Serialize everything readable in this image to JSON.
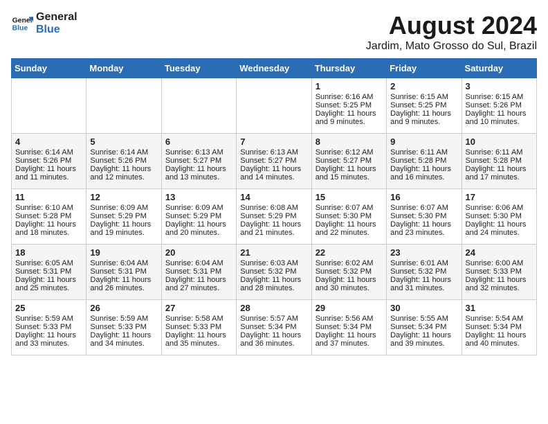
{
  "header": {
    "logo_line1": "General",
    "logo_line2": "Blue",
    "title": "August 2024",
    "subtitle": "Jardim, Mato Grosso do Sul, Brazil"
  },
  "days_of_week": [
    "Sunday",
    "Monday",
    "Tuesday",
    "Wednesday",
    "Thursday",
    "Friday",
    "Saturday"
  ],
  "weeks": [
    [
      {
        "day": "",
        "content": ""
      },
      {
        "day": "",
        "content": ""
      },
      {
        "day": "",
        "content": ""
      },
      {
        "day": "",
        "content": ""
      },
      {
        "day": "1",
        "content": "Sunrise: 6:16 AM\nSunset: 5:25 PM\nDaylight: 11 hours\nand 9 minutes."
      },
      {
        "day": "2",
        "content": "Sunrise: 6:15 AM\nSunset: 5:25 PM\nDaylight: 11 hours\nand 9 minutes."
      },
      {
        "day": "3",
        "content": "Sunrise: 6:15 AM\nSunset: 5:26 PM\nDaylight: 11 hours\nand 10 minutes."
      }
    ],
    [
      {
        "day": "4",
        "content": "Sunrise: 6:14 AM\nSunset: 5:26 PM\nDaylight: 11 hours\nand 11 minutes."
      },
      {
        "day": "5",
        "content": "Sunrise: 6:14 AM\nSunset: 5:26 PM\nDaylight: 11 hours\nand 12 minutes."
      },
      {
        "day": "6",
        "content": "Sunrise: 6:13 AM\nSunset: 5:27 PM\nDaylight: 11 hours\nand 13 minutes."
      },
      {
        "day": "7",
        "content": "Sunrise: 6:13 AM\nSunset: 5:27 PM\nDaylight: 11 hours\nand 14 minutes."
      },
      {
        "day": "8",
        "content": "Sunrise: 6:12 AM\nSunset: 5:27 PM\nDaylight: 11 hours\nand 15 minutes."
      },
      {
        "day": "9",
        "content": "Sunrise: 6:11 AM\nSunset: 5:28 PM\nDaylight: 11 hours\nand 16 minutes."
      },
      {
        "day": "10",
        "content": "Sunrise: 6:11 AM\nSunset: 5:28 PM\nDaylight: 11 hours\nand 17 minutes."
      }
    ],
    [
      {
        "day": "11",
        "content": "Sunrise: 6:10 AM\nSunset: 5:28 PM\nDaylight: 11 hours\nand 18 minutes."
      },
      {
        "day": "12",
        "content": "Sunrise: 6:09 AM\nSunset: 5:29 PM\nDaylight: 11 hours\nand 19 minutes."
      },
      {
        "day": "13",
        "content": "Sunrise: 6:09 AM\nSunset: 5:29 PM\nDaylight: 11 hours\nand 20 minutes."
      },
      {
        "day": "14",
        "content": "Sunrise: 6:08 AM\nSunset: 5:29 PM\nDaylight: 11 hours\nand 21 minutes."
      },
      {
        "day": "15",
        "content": "Sunrise: 6:07 AM\nSunset: 5:30 PM\nDaylight: 11 hours\nand 22 minutes."
      },
      {
        "day": "16",
        "content": "Sunrise: 6:07 AM\nSunset: 5:30 PM\nDaylight: 11 hours\nand 23 minutes."
      },
      {
        "day": "17",
        "content": "Sunrise: 6:06 AM\nSunset: 5:30 PM\nDaylight: 11 hours\nand 24 minutes."
      }
    ],
    [
      {
        "day": "18",
        "content": "Sunrise: 6:05 AM\nSunset: 5:31 PM\nDaylight: 11 hours\nand 25 minutes."
      },
      {
        "day": "19",
        "content": "Sunrise: 6:04 AM\nSunset: 5:31 PM\nDaylight: 11 hours\nand 26 minutes."
      },
      {
        "day": "20",
        "content": "Sunrise: 6:04 AM\nSunset: 5:31 PM\nDaylight: 11 hours\nand 27 minutes."
      },
      {
        "day": "21",
        "content": "Sunrise: 6:03 AM\nSunset: 5:32 PM\nDaylight: 11 hours\nand 28 minutes."
      },
      {
        "day": "22",
        "content": "Sunrise: 6:02 AM\nSunset: 5:32 PM\nDaylight: 11 hours\nand 30 minutes."
      },
      {
        "day": "23",
        "content": "Sunrise: 6:01 AM\nSunset: 5:32 PM\nDaylight: 11 hours\nand 31 minutes."
      },
      {
        "day": "24",
        "content": "Sunrise: 6:00 AM\nSunset: 5:33 PM\nDaylight: 11 hours\nand 32 minutes."
      }
    ],
    [
      {
        "day": "25",
        "content": "Sunrise: 5:59 AM\nSunset: 5:33 PM\nDaylight: 11 hours\nand 33 minutes."
      },
      {
        "day": "26",
        "content": "Sunrise: 5:59 AM\nSunset: 5:33 PM\nDaylight: 11 hours\nand 34 minutes."
      },
      {
        "day": "27",
        "content": "Sunrise: 5:58 AM\nSunset: 5:33 PM\nDaylight: 11 hours\nand 35 minutes."
      },
      {
        "day": "28",
        "content": "Sunrise: 5:57 AM\nSunset: 5:34 PM\nDaylight: 11 hours\nand 36 minutes."
      },
      {
        "day": "29",
        "content": "Sunrise: 5:56 AM\nSunset: 5:34 PM\nDaylight: 11 hours\nand 37 minutes."
      },
      {
        "day": "30",
        "content": "Sunrise: 5:55 AM\nSunset: 5:34 PM\nDaylight: 11 hours\nand 39 minutes."
      },
      {
        "day": "31",
        "content": "Sunrise: 5:54 AM\nSunset: 5:34 PM\nDaylight: 11 hours\nand 40 minutes."
      }
    ]
  ]
}
